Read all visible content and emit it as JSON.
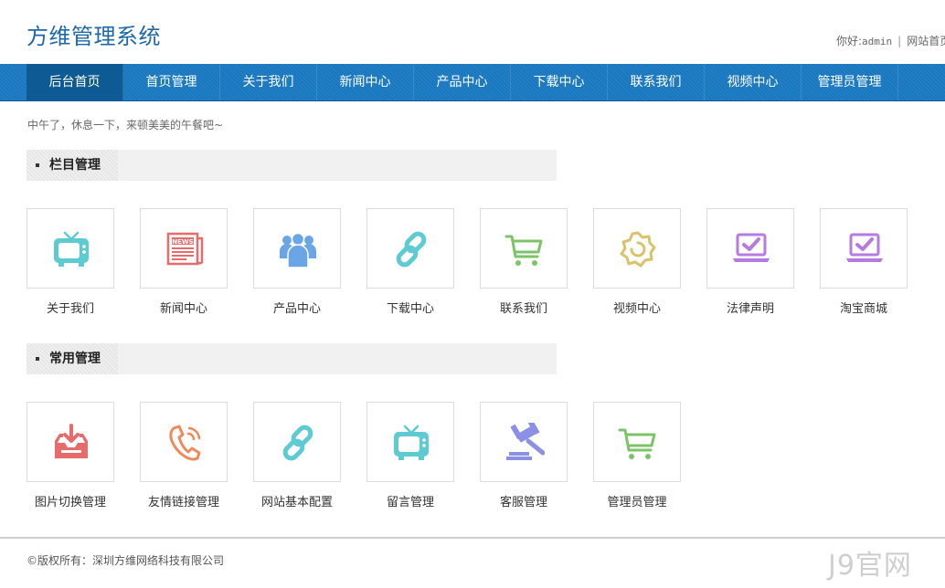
{
  "header": {
    "logo": "方维管理系统",
    "greeting_prefix": "你好:",
    "username": "admin",
    "separator": "|",
    "home_link": "网站首页"
  },
  "nav": {
    "items": [
      {
        "label": "后台首页",
        "active": true
      },
      {
        "label": "首页管理"
      },
      {
        "label": "关于我们"
      },
      {
        "label": "新闻中心"
      },
      {
        "label": "产品中心"
      },
      {
        "label": "下载中心"
      },
      {
        "label": "联系我们"
      },
      {
        "label": "视频中心"
      },
      {
        "label": "管理员管理"
      }
    ]
  },
  "greeting": "中午了，休息一下，来顿美美的午餐吧~",
  "sections": [
    {
      "title": "栏目管理",
      "tiles": [
        {
          "label": "关于我们",
          "icon": "tv-icon",
          "color": "#5ecbd3"
        },
        {
          "label": "新闻中心",
          "icon": "newspaper-icon",
          "color": "#e86b6b"
        },
        {
          "label": "产品中心",
          "icon": "users-icon",
          "color": "#6aa6e6"
        },
        {
          "label": "下载中心",
          "icon": "link-icon",
          "color": "#5ecbd3"
        },
        {
          "label": "联系我们",
          "icon": "cart-icon",
          "color": "#7cc36a"
        },
        {
          "label": "视频中心",
          "icon": "gear-icon",
          "color": "#d9c26a"
        },
        {
          "label": "法律声明",
          "icon": "laptop-check-icon",
          "color": "#b57be0"
        },
        {
          "label": "淘宝商城",
          "icon": "laptop-check-icon",
          "color": "#b57be0"
        }
      ]
    },
    {
      "title": "常用管理",
      "tiles": [
        {
          "label": "图片切换管理",
          "icon": "inbox-download-icon",
          "color": "#e86b6b"
        },
        {
          "label": "友情链接管理",
          "icon": "phone-icon",
          "color": "#ee8a5a"
        },
        {
          "label": "网站基本配置",
          "icon": "link-icon",
          "color": "#5ecbd3"
        },
        {
          "label": "留言管理",
          "icon": "tv-icon",
          "color": "#5ecbd3"
        },
        {
          "label": "客服管理",
          "icon": "gavel-icon",
          "color": "#8b8fe6"
        },
        {
          "label": "管理员管理",
          "icon": "cart-icon",
          "color": "#7cc36a"
        }
      ]
    }
  ],
  "footer": {
    "copyright": "©版权所有：深圳方维网络科技有限公司",
    "watermark": "J9官网"
  }
}
